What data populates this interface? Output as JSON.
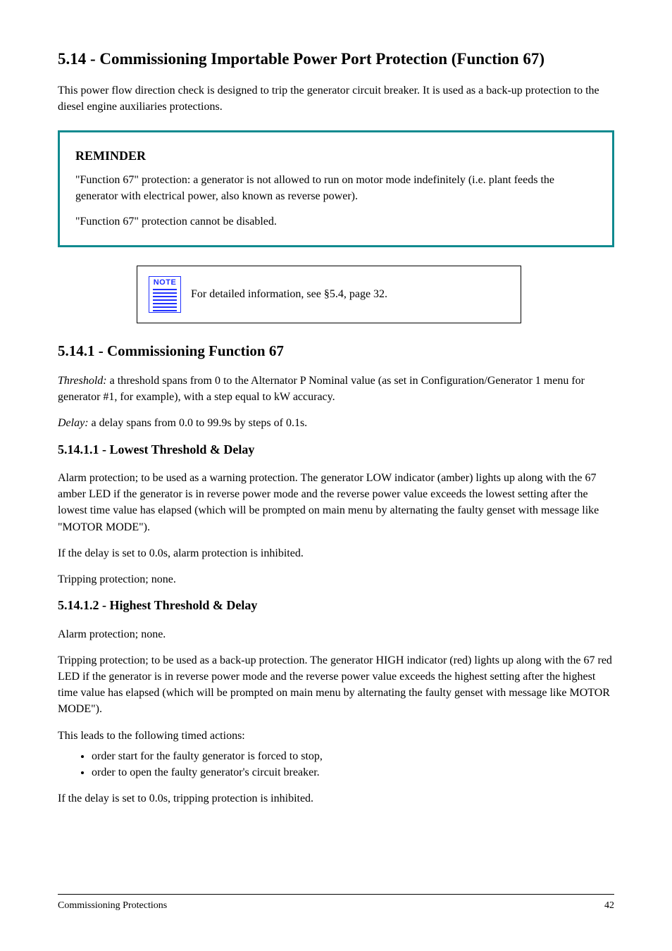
{
  "section": {
    "title": "5.14 - Commissioning Importable Power Port Protection (Function 67)"
  },
  "intro": "This power flow direction check is designed to trip the generator circuit breaker. It is used as a back-up protection to the diesel engine auxiliaries protections.",
  "callout": {
    "title": "REMINDER",
    "para1": "\"Function 67\" protection: a generator is not allowed to run on motor mode indefinitely (i.e. plant feeds the generator with electrical power, also known as reverse power).",
    "para2": "\"Function 67\" protection cannot be disabled."
  },
  "note": {
    "iconLabel": "NOTE",
    "text": "For detailed information, see §5.4, page 32."
  },
  "commission": {
    "title": "5.14.1 - Commissioning Function 67",
    "threshold_label": "Threshold:",
    "threshold_text": "a threshold spans from 0 to the Alternator P Nominal value (as set in Configuration/Generator 1 menu for generator #1, for example), with a step equal to kW accuracy.",
    "delay_label": "Delay:",
    "delay_text": "a delay spans from 0.0 to 99.9s by steps of 0.1s."
  },
  "lowest": {
    "title": "5.14.1.1 - Lowest Threshold & Delay",
    "alarm_para": "Alarm protection; to be used as a warning protection. The generator LOW indicator (amber) lights up along with the 67 amber LED if the generator is in reverse power mode and the reverse power value exceeds the lowest setting after the lowest time value has elapsed (which will be prompted on main menu by alternating the faulty genset with message like \"MOTOR MODE\").",
    "alarm_note": "If the delay is set to 0.0s, alarm protection is inhibited.",
    "trip_para": "Tripping protection; none."
  },
  "highest": {
    "title": "5.14.1.2 - Highest Threshold & Delay",
    "alarm_para": "Alarm protection; none.",
    "trip_para": "Tripping protection; to be used as a back-up protection. The generator HIGH indicator (red) lights up along with the 67 red LED if the generator is in reverse power mode and the reverse power value exceeds the highest setting after the highest time value has elapsed (which will be prompted on main menu by alternating the faulty genset with message like MOTOR MODE\").",
    "trip_actions_lead": "This leads to the following timed actions:",
    "trip_actions": [
      "order start for the faulty generator is forced to stop,",
      "order to open the faulty generator's circuit breaker."
    ],
    "trip_note": "If the delay is set to 0.0s, tripping protection is inhibited."
  },
  "footer": {
    "left": "Commissioning Protections",
    "right": "42"
  }
}
